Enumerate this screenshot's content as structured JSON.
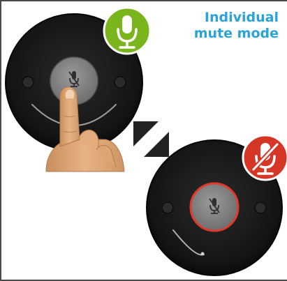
{
  "title": {
    "line1": "Individual",
    "line2": "mute mode"
  },
  "colors": {
    "title": "#2aa3d8",
    "unmuted_badge": "#7ab51d",
    "muted_badge": "#d63626",
    "muted_ring": "#e13a2b",
    "device_body": "#161616",
    "center_button": "#8a8a8a"
  },
  "icons": {
    "unmuted": "microphone-icon",
    "muted": "microphone-muted-icon",
    "transition": "diagonal-split-icon",
    "hand": "finger-pointing-icon"
  },
  "states": [
    {
      "name": "unmuted",
      "badge_icon": "microphone-icon"
    },
    {
      "name": "muted",
      "badge_icon": "microphone-muted-icon"
    }
  ]
}
